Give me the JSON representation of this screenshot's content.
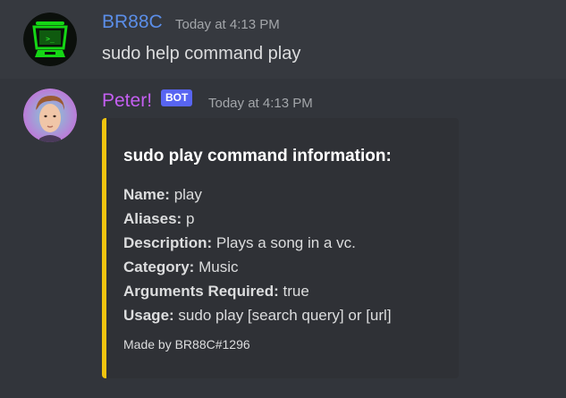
{
  "messages": [
    {
      "username": "BR88C",
      "timestamp": "Today at 4:13 PM",
      "content": "sudo help command play",
      "avatar_icon": "green-computer-avatar",
      "name_color": "#5b8ee8"
    },
    {
      "username": "Peter!",
      "bot_tag": "BOT",
      "timestamp": "Today at 4:13 PM",
      "avatar_icon": "person-face-avatar",
      "name_color": "#c45ff1",
      "embed": {
        "accent_color": "#f1c40f",
        "title": "sudo play command information:",
        "fields": [
          {
            "key": "Name:",
            "value": "play"
          },
          {
            "key": "Aliases:",
            "value": "p"
          },
          {
            "key": "Description:",
            "value": "Plays a song in a vc."
          },
          {
            "key": "Category:",
            "value": "Music"
          },
          {
            "key": "Arguments Required:",
            "value": "true"
          },
          {
            "key": "Usage:",
            "value": "sudo play [search query] or [url]"
          }
        ],
        "footer": "Made by BR88C#1296"
      }
    }
  ]
}
